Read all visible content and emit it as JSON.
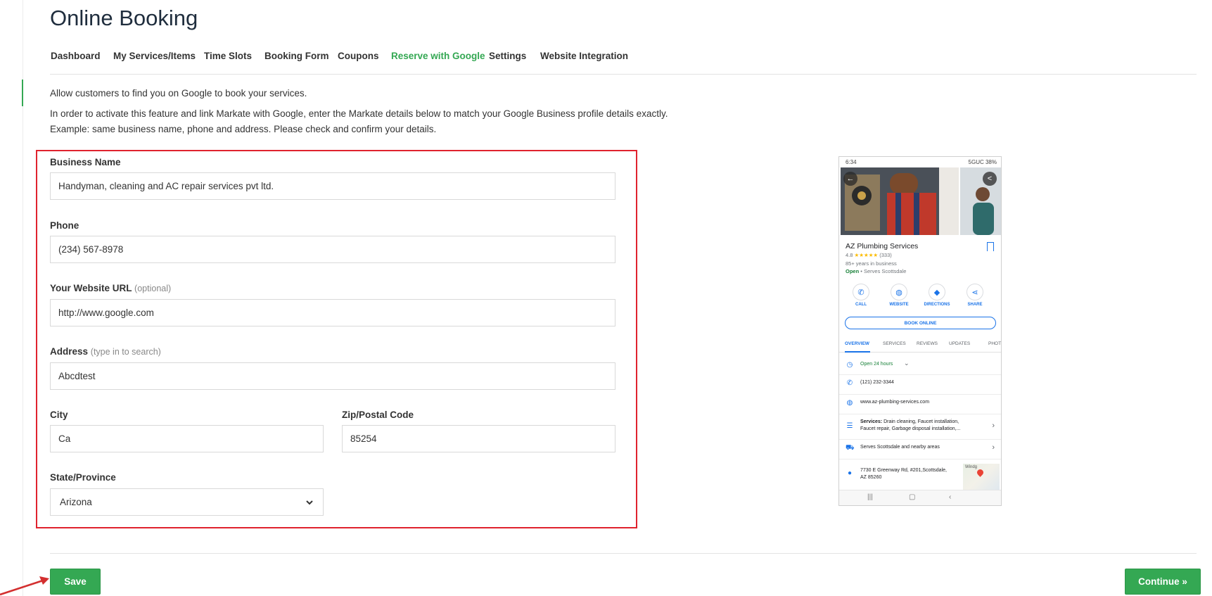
{
  "page": {
    "title": "Online Booking"
  },
  "tabs": [
    {
      "label": "Dashboard",
      "active": false
    },
    {
      "label": "My Services/Items",
      "active": false
    },
    {
      "label": "Time Slots",
      "active": false
    },
    {
      "label": "Booking Form",
      "active": false
    },
    {
      "label": "Coupons",
      "active": false
    },
    {
      "label": "Reserve with Google",
      "active": true
    },
    {
      "label": "Settings",
      "active": false
    },
    {
      "label": "Website Integration",
      "active": false
    }
  ],
  "intro": {
    "line1": "Allow customers to find you on Google to book your services.",
    "line2": "In order to activate this feature and link Markate with Google, enter the Markate details below to match your Google Business profile details exactly.",
    "line3": "Example: same business name, phone and address. Please check and confirm your details."
  },
  "form": {
    "business_name": {
      "label": "Business Name",
      "value": "Handyman, cleaning and AC repair services pvt ltd."
    },
    "phone": {
      "label": "Phone",
      "value": "(234) 567-8978"
    },
    "website": {
      "label": "Your Website URL",
      "hint": "(optional)",
      "value": "http://www.google.com"
    },
    "address": {
      "label": "Address",
      "hint": "(type in to search)",
      "value": "Abcdtest"
    },
    "city": {
      "label": "City",
      "value": "Ca"
    },
    "zip": {
      "label": "Zip/Postal Code",
      "value": "85254"
    },
    "state": {
      "label": "State/Province",
      "value": "Arizona"
    }
  },
  "buttons": {
    "save": "Save",
    "continue": "Continue »"
  },
  "preview": {
    "status_time": "6:34",
    "status_indicators": "5GUC 38%",
    "business_name": "AZ Plumbing Services",
    "rating": "4.8",
    "stars": "★★★★★",
    "reviews": "(333)",
    "years": "85+ years in business",
    "open_label": "Open",
    "serves": "• Serves Scottsdale",
    "actions": [
      "CALL",
      "WEBSITE",
      "DIRECTIONS",
      "SHARE"
    ],
    "book_online": "BOOK ONLINE",
    "tabs": [
      "OVERVIEW",
      "SERVICES",
      "REVIEWS",
      "UPDATES",
      "PHOT"
    ],
    "hours": "Open 24 hours",
    "phone": "(121) 232-3344",
    "website": "www.az-plumbing-services.com",
    "services_label": "Services:",
    "services_line1": "Drain cleaning, Faucet installation,",
    "services_line2": "Faucet repair, Garbage disposal installation,...",
    "serves_area": "Serves Scottsdale and nearby areas",
    "address_line1": "7730 E Greenway Rd, #201,Scottsdale,",
    "address_line2": "AZ 85260",
    "map_label": "Windg"
  },
  "colors": {
    "accent": "#34a853",
    "highlight_box": "#e0232e",
    "arrow": "#d32f2f",
    "google_blue": "#1a73e8"
  }
}
